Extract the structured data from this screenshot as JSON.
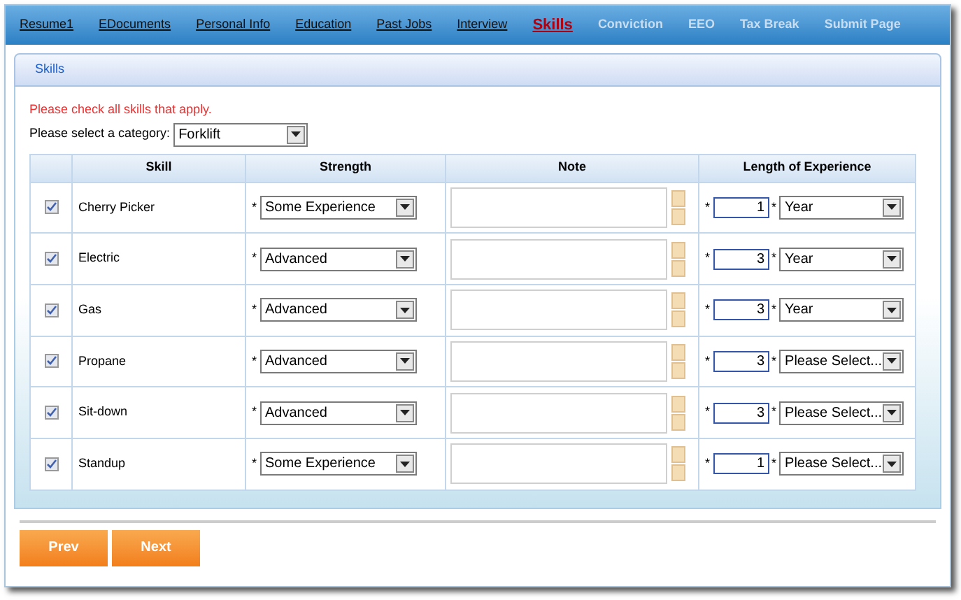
{
  "tabs": [
    {
      "label": "Resume1",
      "selected": false,
      "disabled": false
    },
    {
      "label": "EDocuments",
      "selected": false,
      "disabled": false
    },
    {
      "label": "Personal Info",
      "selected": false,
      "disabled": false
    },
    {
      "label": "Education",
      "selected": false,
      "disabled": false
    },
    {
      "label": "Past Jobs",
      "selected": false,
      "disabled": false
    },
    {
      "label": "Interview",
      "selected": false,
      "disabled": false
    },
    {
      "label": "Skills",
      "selected": true,
      "disabled": false
    },
    {
      "label": "Conviction",
      "selected": false,
      "disabled": true
    },
    {
      "label": "EEO",
      "selected": false,
      "disabled": true
    },
    {
      "label": "Tax Break",
      "selected": false,
      "disabled": true
    },
    {
      "label": "Submit Page",
      "selected": false,
      "disabled": true
    }
  ],
  "panel_title": "Skills",
  "instruction": "Please check all skills that apply.",
  "category": {
    "label": "Please select a category:",
    "value": "Forklift"
  },
  "table": {
    "columns": [
      "Skill",
      "Strength",
      "Note",
      "Length of Experience"
    ],
    "rows": [
      {
        "checked": true,
        "skill": "Cherry Picker",
        "required_mark": "*",
        "strength": "Some Experience",
        "amount": "1",
        "unit": "Year"
      },
      {
        "checked": true,
        "skill": "Electric",
        "required_mark": "*",
        "strength": "Advanced",
        "amount": "3",
        "unit": "Year"
      },
      {
        "checked": true,
        "skill": "Gas",
        "required_mark": "*",
        "strength": "Advanced",
        "amount": "3",
        "unit": "Year"
      },
      {
        "checked": true,
        "skill": "Propane",
        "required_mark": "*",
        "strength": "Advanced",
        "amount": "3",
        "unit": "Please Select..."
      },
      {
        "checked": true,
        "skill": "Sit-down",
        "required_mark": "*",
        "strength": "Advanced",
        "amount": "3",
        "unit": "Please Select..."
      },
      {
        "checked": true,
        "skill": "Standup",
        "required_mark": "*",
        "strength": "Some Experience",
        "amount": "1",
        "unit": "Please Select..."
      }
    ]
  },
  "buttons": [
    "Prev",
    "Next"
  ]
}
